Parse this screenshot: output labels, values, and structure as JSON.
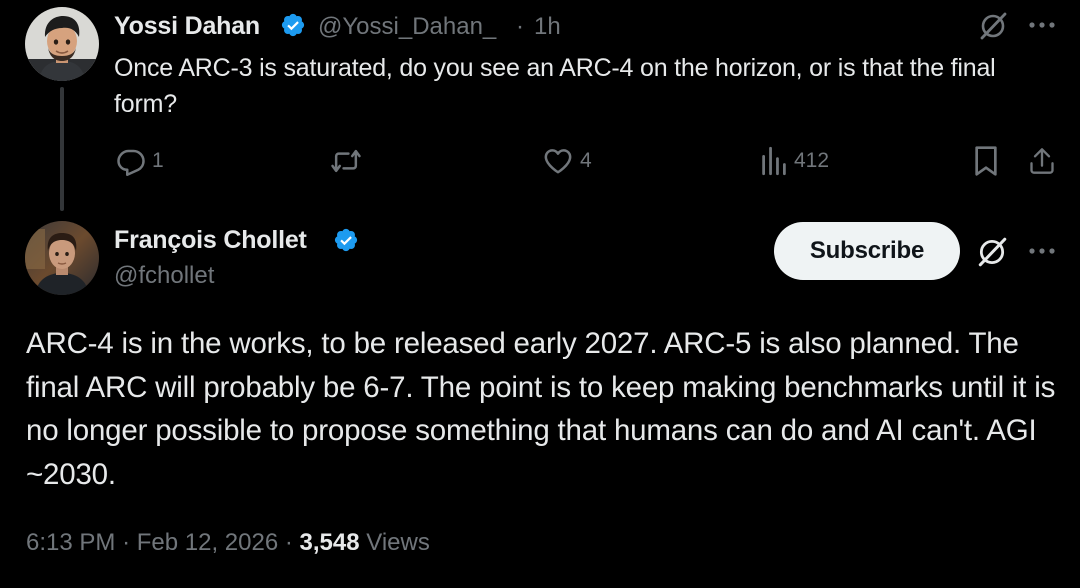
{
  "reply": {
    "author_name": "Yossi Dahan",
    "handle": "@Yossi_Dahan_",
    "separator": "·",
    "time": "1h",
    "text": "Once ARC-3 is saturated, do you see an ARC-4 on the horizon, or is that the final form?",
    "actions": {
      "reply_count": "1",
      "repost_count": "",
      "like_count": "4",
      "views_count": "412"
    }
  },
  "main": {
    "author_name": "François Chollet",
    "handle": "@fchollet",
    "subscribe_label": "Subscribe",
    "text": "ARC-4 is in the works, to be released early 2027. ARC-5 is also planned. The final ARC will probably be 6-7. The point is to keep making benchmarks until it is no longer possible to propose something that humans can do and AI can't. AGI ~2030.",
    "timestamp": "6:13 PM",
    "date": "Feb 12, 2026",
    "views_count": "3,548",
    "views_label": "Views",
    "dot": "·"
  },
  "colors": {
    "background": "#000000",
    "text_primary": "#e7e9ea",
    "text_secondary": "#71767b",
    "verified_badge": "#1d9bf0",
    "subscribe_bg": "#eff3f4"
  },
  "icons": {
    "verified": "verified-badge-icon",
    "grok": "grok-icon",
    "more": "more-icon",
    "reply": "reply-icon",
    "repost": "repost-icon",
    "like": "like-icon",
    "views": "views-icon",
    "bookmark": "bookmark-icon",
    "share": "share-icon"
  }
}
